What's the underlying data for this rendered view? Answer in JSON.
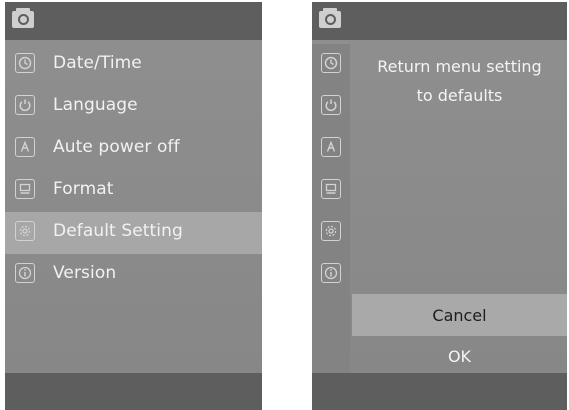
{
  "left_screen": {
    "menu": [
      {
        "label": "Date/Time",
        "icon": "clock-icon"
      },
      {
        "label": "Language",
        "icon": "power-icon"
      },
      {
        "label": "Aute power off",
        "icon": "a-box-icon"
      },
      {
        "label": "Format",
        "icon": "format-icon"
      },
      {
        "label": "Default Setting",
        "icon": "gear-icon",
        "selected": true
      },
      {
        "label": "Version",
        "icon": "info-icon"
      }
    ]
  },
  "right_screen": {
    "message_line1": "Return menu setting",
    "message_line2": "to defaults",
    "cancel_label": "Cancel",
    "ok_label": "OK",
    "selected_option": "Cancel"
  },
  "colors": {
    "screen_bg": "#8f8f8f",
    "bar_bg": "#5e5e5e",
    "highlight": "#a7a7a7",
    "text": "#f2f2f2"
  }
}
